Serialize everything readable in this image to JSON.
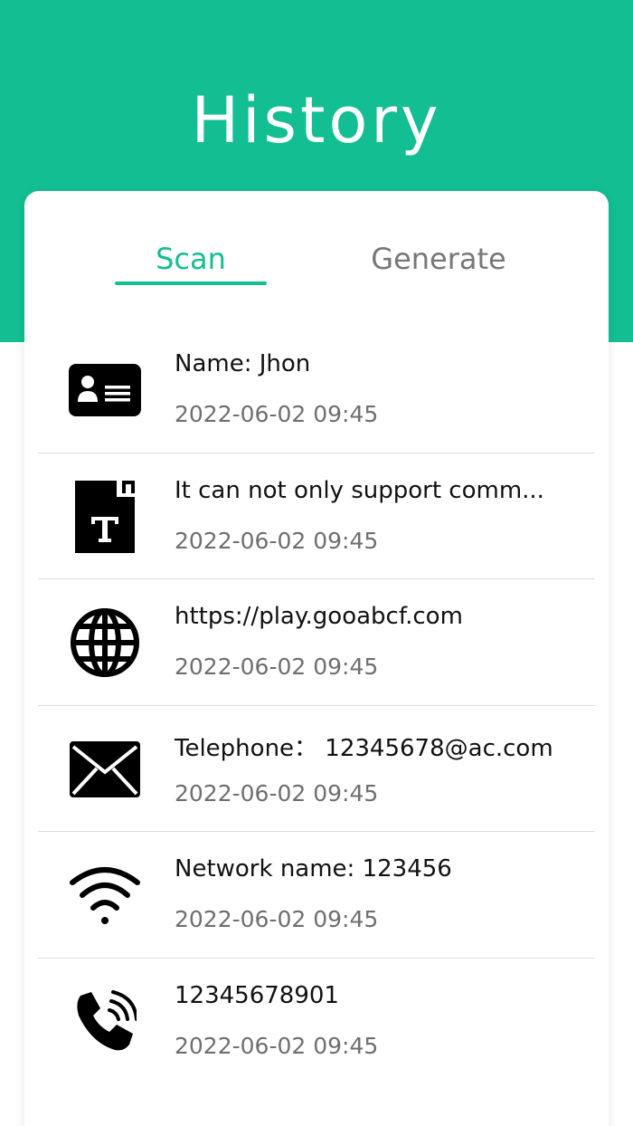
{
  "header": {
    "title": "History",
    "color": "#13be93"
  },
  "tabs": [
    {
      "label": "Scan",
      "active": true
    },
    {
      "label": "Generate",
      "active": false
    }
  ],
  "items": [
    {
      "icon": "contact-card-icon",
      "title": "Name: Jhon",
      "time": "2022-06-02 09:45"
    },
    {
      "icon": "text-document-icon",
      "title": "It can not only support comm...",
      "time": "2022-06-02 09:45"
    },
    {
      "icon": "globe-icon",
      "title": "https://play.gooabcf.com",
      "time": "2022-06-02 09:45"
    },
    {
      "icon": "envelope-icon",
      "title": "Telephone： 12345678@ac.com",
      "time": "2022-06-02 09:45"
    },
    {
      "icon": "wifi-icon",
      "title": "Network name: 123456",
      "time": "2022-06-02 09:45"
    },
    {
      "icon": "phone-call-icon",
      "title": "12345678901",
      "time": "2022-06-02 09:45"
    }
  ]
}
